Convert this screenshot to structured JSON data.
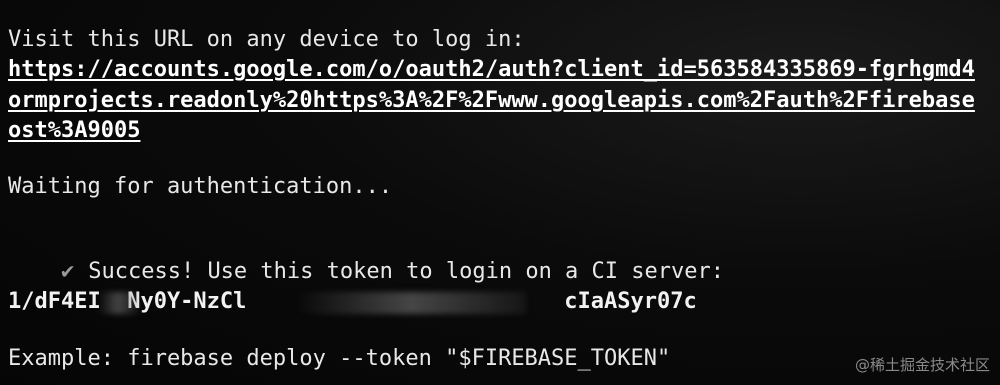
{
  "terminal": {
    "visit_text": "Visit this URL on any device to log in:",
    "url_line_1": "https://accounts.google.com/o/oauth2/auth?client_id=563584335869-fgrhgmd4",
    "url_line_2": "ormprojects.readonly%20https%3A%2F%2Fwww.googleapis.com%2Fauth%2Ffirebase",
    "url_line_3": "ost%3A9005",
    "waiting_text": "Waiting for authentication...",
    "success_icon": "check-icon",
    "success_text": "Success! Use this token to login on a CI server:",
    "token_visible": "1/dF4EI  Ny0Y-NzCl                        cIaASyr07c",
    "example_text": "Example: firebase deploy --token \"$FIREBASE_TOKEN\""
  },
  "watermark": {
    "text": "@稀土掘金技术社区"
  }
}
